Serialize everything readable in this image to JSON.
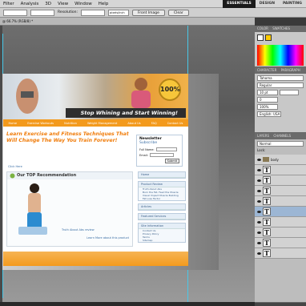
{
  "menubar": {
    "items": [
      "Filter",
      "Analysis",
      "3D",
      "View",
      "Window",
      "Help"
    ],
    "workspaces": [
      "ESSENTIALS",
      "DESIGN",
      "PAINTING"
    ]
  },
  "options": {
    "resolution_label": "Resolution:",
    "unit": "pixels/inch",
    "front_image": "Front Image",
    "clear": "Clear"
  },
  "doc_tab": {
    "title": "@ 66.7% (RGB/8) *"
  },
  "site": {
    "badge": "100%",
    "banner_text": "Stop Whining and Start Winning!",
    "nav": [
      "Home",
      "Exercise Workouts",
      "Nutrition",
      "Weight Management",
      "About Us",
      "FAQ",
      "Contact Us"
    ],
    "headline_line1": "Learn Exercise and Fitness Techniques That",
    "headline_line2": "Will Change The Way You Train Forever!",
    "newsletter": {
      "title": "Newsletter",
      "subscribe": "Subscribe",
      "name_label": "Full Name:",
      "email_label": "Email:",
      "submit": "Submit"
    },
    "rec_title": "Our TOP Recommendation",
    "rec_link1": "Click Here",
    "rec_caption": "Truth About Abs review",
    "rec_link2": "Learn More about this product",
    "sidebar": {
      "sec1_title": "Home",
      "sec2_title": "Product Review",
      "sec2_links": [
        "Truth About Abs",
        "Burn the Fat, Feed the Muscle",
        "Visual Impact Muscle Building",
        "Fat Loss Factor"
      ],
      "sec3_title": "Articles",
      "sec4_title": "Featured Services",
      "sec5_title": "Site Information",
      "sec5_links": [
        "Contact Us",
        "Privacy Policy",
        "Terms",
        "Sitemap"
      ]
    }
  },
  "panels": {
    "color_tabs": [
      "COLOR",
      "SWATCHES"
    ],
    "char_tabs": [
      "CHARACTER",
      "PARAGRAPH"
    ],
    "font": "Tahoma",
    "style": "Regular",
    "size": "10 pt",
    "tracking": "0",
    "scale": "100%",
    "language": "English: USA",
    "layer_tabs": [
      "LAYERS",
      "CHANNELS"
    ],
    "blend": "Normal",
    "lock_label": "Lock:",
    "group_name": "body",
    "layers": [
      "T",
      "T",
      "T",
      "T",
      "T",
      "T",
      "T",
      "T",
      "T"
    ]
  },
  "colors": {
    "orange": "#f39a1d",
    "title_orange": "#f07d0c",
    "header_gray": "#5c5c5c",
    "ps_dark": "#3a3a3a"
  }
}
